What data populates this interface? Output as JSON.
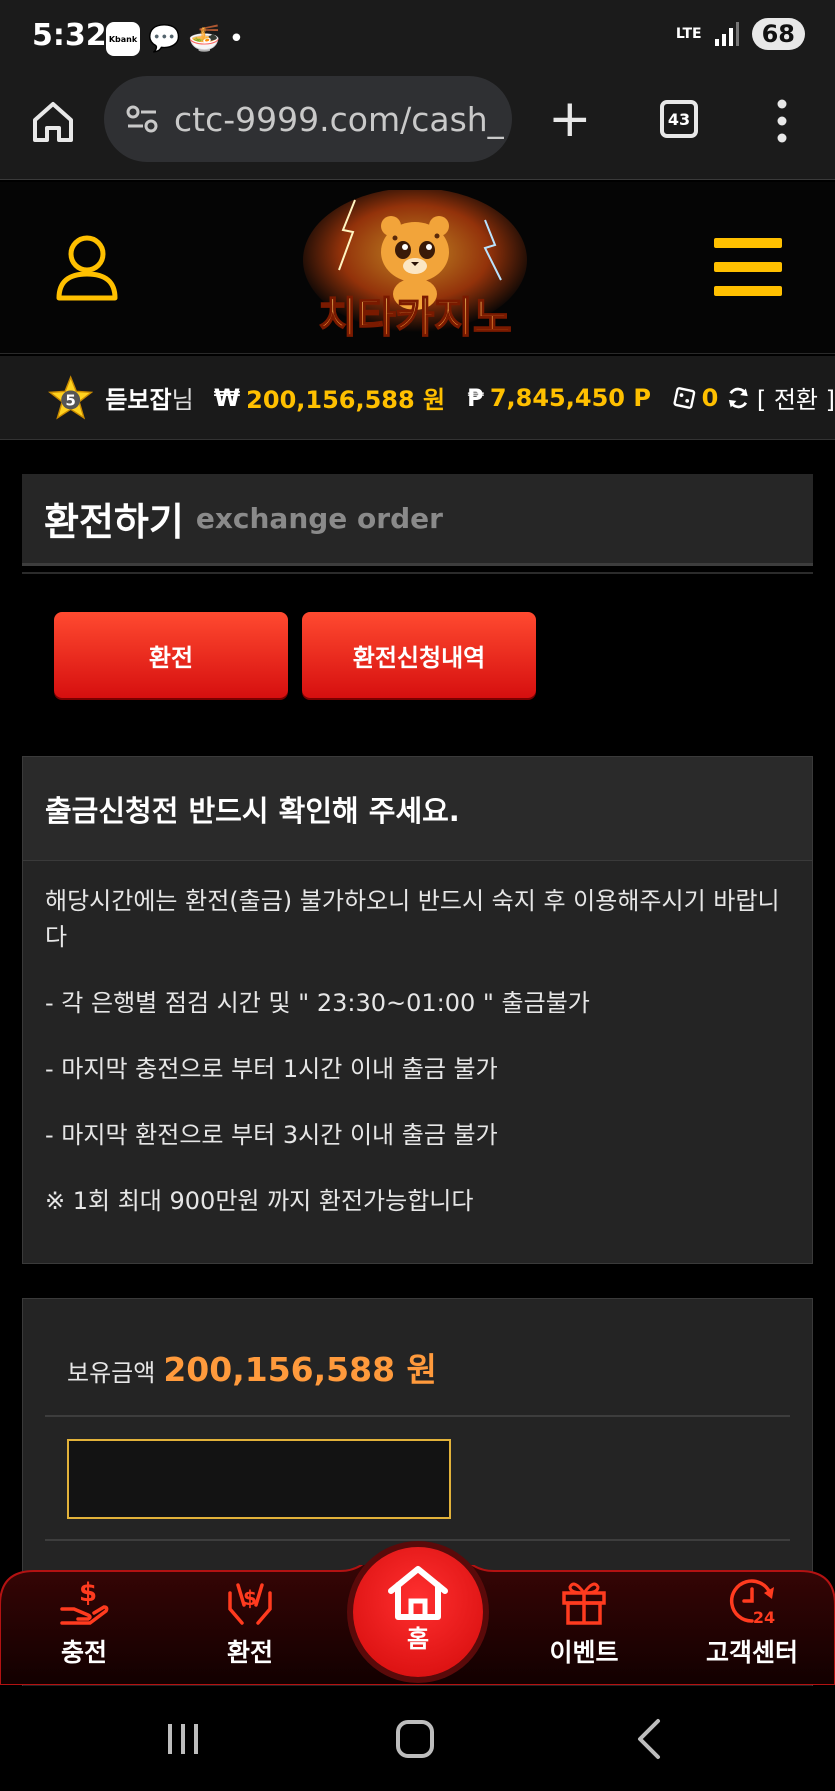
{
  "status_bar": {
    "time": "5:32",
    "kbank_label": "Kbank",
    "dot": "•",
    "network": "LTE",
    "battery": "68"
  },
  "browser": {
    "url": "ctc-9999.com/cash_",
    "tab_count": "43"
  },
  "user_bar": {
    "level": "5",
    "username": "듣보잡",
    "honorific": "님",
    "won_symbol": "₩",
    "cash": "200,156,588 원",
    "point_symbol": "₱",
    "points": "7,845,450 P",
    "coupons": "0",
    "switch_label": "[ 전환 ]"
  },
  "page_title": {
    "korean": "환전하기",
    "english": "exchange order"
  },
  "buttons": {
    "exchange": "환전",
    "history": "환전신청내역"
  },
  "notice": {
    "title": "출금신청전 반드시 확인해 주세요.",
    "lines": [
      "해당시간에는 환전(출금) 불가하오니 반드시 숙지 후 이용해주시기 바랍니다",
      "- 각 은행별 점검 시간 및 \" 23:30~01:00 \" 출금불가",
      "- 마지막 충전으로 부터 1시간 이내 출금 불가",
      "- 마지막 환전으로 부터 3시간 이내 출금 불가",
      "※ 1회 최대 900만원 까지 환전가능합니다"
    ]
  },
  "balance": {
    "label": "보유금액",
    "value": "200,156,588 원"
  },
  "bottom_nav": {
    "charge": "충전",
    "exchange": "환전",
    "home": "홈",
    "event": "이벤트",
    "support": "고객센터"
  },
  "colors": {
    "accent_gold": "#ffc000",
    "accent_red": "#e8160f",
    "balance_orange": "#ff9a3c",
    "panel_bg": "#242424"
  }
}
